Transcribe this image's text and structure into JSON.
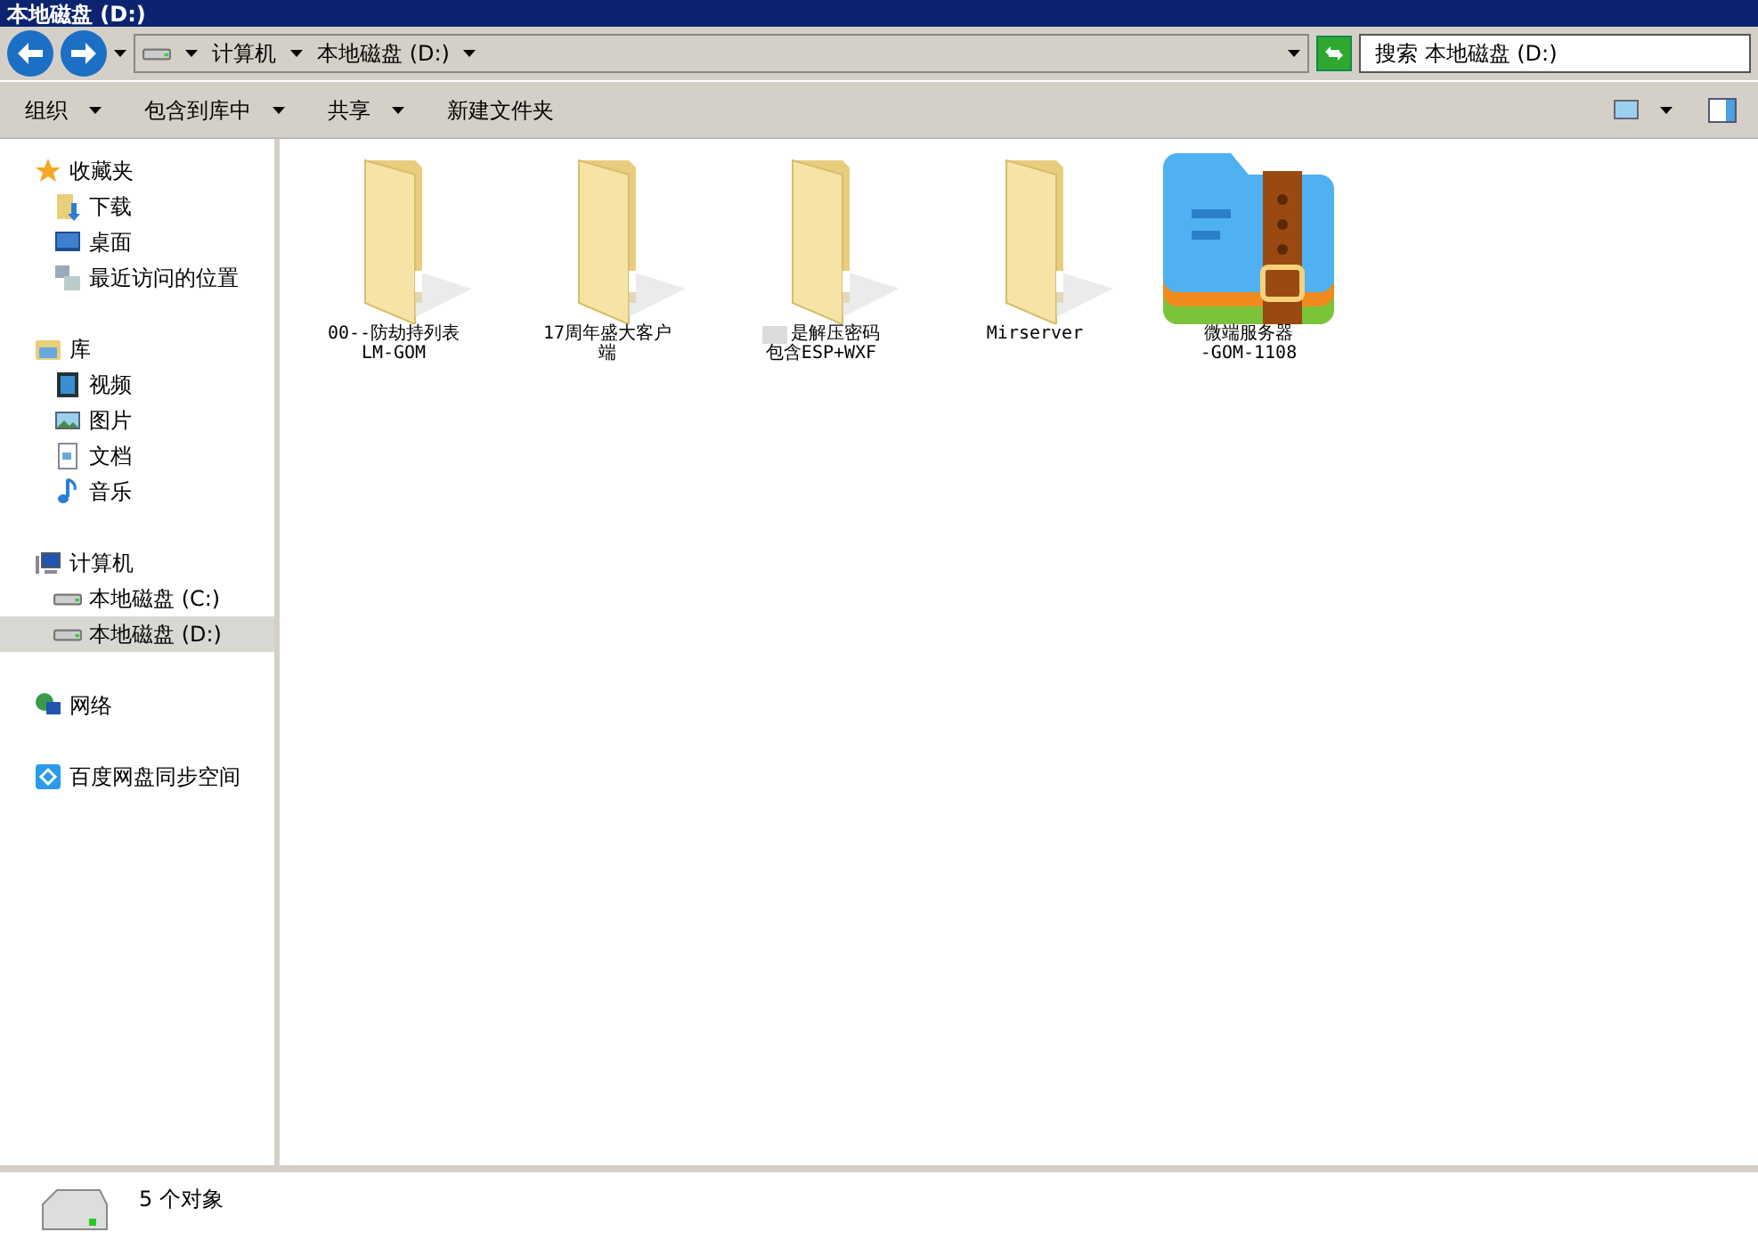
{
  "window": {
    "title": "本地磁盘 (D:)"
  },
  "address_bar": {
    "segments": [
      "计算机",
      "本地磁盘 (D:)"
    ]
  },
  "search": {
    "placeholder": "搜索 本地磁盘 (D:)"
  },
  "toolbar": {
    "items": [
      {
        "label": "组织",
        "dropdown": true
      },
      {
        "label": "包含到库中",
        "dropdown": true
      },
      {
        "label": "共享",
        "dropdown": true
      },
      {
        "label": "新建文件夹",
        "dropdown": false
      }
    ]
  },
  "sidebar": {
    "groups": [
      {
        "label": "收藏夹",
        "selected": false,
        "children": [
          {
            "label": "下载",
            "selected": false
          },
          {
            "label": "桌面",
            "selected": false
          },
          {
            "label": "最近访问的位置",
            "selected": false
          }
        ]
      },
      {
        "label": "库",
        "selected": false,
        "children": [
          {
            "label": "视频",
            "selected": false
          },
          {
            "label": "图片",
            "selected": false
          },
          {
            "label": "文档",
            "selected": false
          },
          {
            "label": "音乐",
            "selected": false
          }
        ]
      },
      {
        "label": "计算机",
        "selected": false,
        "children": [
          {
            "label": "本地磁盘 (C:)",
            "selected": false
          },
          {
            "label": "本地磁盘 (D:)",
            "selected": true
          }
        ]
      },
      {
        "label": "网络",
        "selected": false
      },
      {
        "label": "百度网盘同步空间",
        "selected": false
      }
    ]
  },
  "files": [
    {
      "kind": "folder",
      "name": [
        "00--防劫持列表",
        "LM-GOM"
      ],
      "blurred": false
    },
    {
      "kind": "folder",
      "name": [
        "17周年盛大客户",
        "端"
      ],
      "blurred": false
    },
    {
      "kind": "folder",
      "name": [
        "是解压密码",
        "包含ESP+WXF"
      ],
      "blurred": true
    },
    {
      "kind": "folder",
      "name": [
        "Mirserver"
      ],
      "blurred": false
    },
    {
      "kind": "zip",
      "name": [
        "微端服务器",
        "-GOM-1108"
      ],
      "blurred": false
    }
  ],
  "status_bar": {
    "count": "5 个对象"
  }
}
